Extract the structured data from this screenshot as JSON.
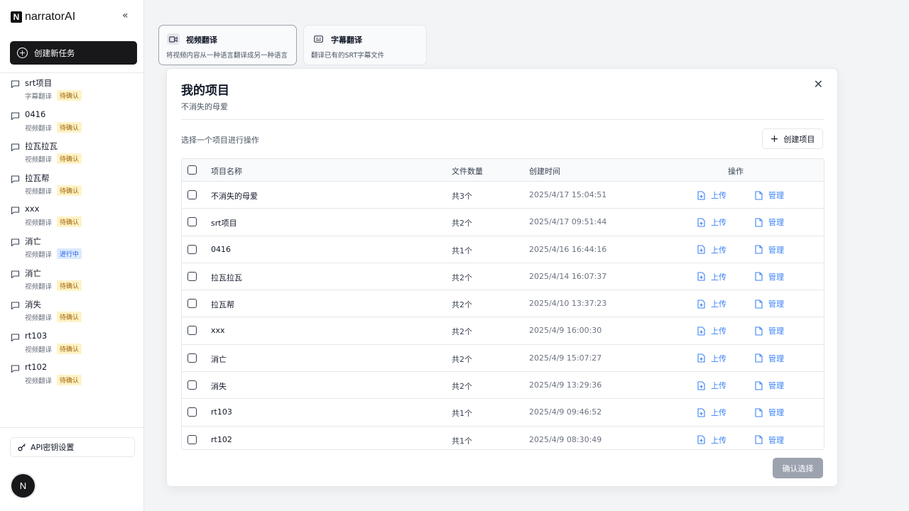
{
  "app": {
    "logo_letter": "N",
    "name": "narratorAI",
    "collapse_glyph": "«"
  },
  "sidebar": {
    "new_task_label": "创建新任务",
    "tasks": [
      {
        "title": "srt项目",
        "type": "字幕翻译",
        "status": "待确认",
        "status_kind": "pending"
      },
      {
        "title": "0416",
        "type": "视频翻译",
        "status": "待确认",
        "status_kind": "pending"
      },
      {
        "title": "拉瓦拉瓦",
        "type": "视频翻译",
        "status": "待确认",
        "status_kind": "pending"
      },
      {
        "title": "拉瓦帮",
        "type": "视频翻译",
        "status": "待确认",
        "status_kind": "pending"
      },
      {
        "title": "xxx",
        "type": "视频翻译",
        "status": "待确认",
        "status_kind": "pending"
      },
      {
        "title": "消亡",
        "type": "视频翻译",
        "status": "进行中",
        "status_kind": "progress"
      },
      {
        "title": "消亡",
        "type": "视频翻译",
        "status": "待确认",
        "status_kind": "pending"
      },
      {
        "title": "消失",
        "type": "视频翻译",
        "status": "待确认",
        "status_kind": "pending"
      },
      {
        "title": "rt103",
        "type": "视频翻译",
        "status": "待确认",
        "status_kind": "pending"
      },
      {
        "title": "rt102",
        "type": "视频翻译",
        "status": "待确认",
        "status_kind": "pending"
      }
    ],
    "api_settings_label": "API密钥设置",
    "avatar_letter": "N"
  },
  "modes": [
    {
      "title": "视频翻译",
      "desc": "将视频内容从一种语言翻译成另一种语言",
      "icon": "video-icon",
      "active": true
    },
    {
      "title": "字幕翻译",
      "desc": "翻译已有的SRT字幕文件",
      "icon": "subtitles-icon",
      "active": false
    }
  ],
  "modal": {
    "title": "我的项目",
    "subtitle": "不消失的母爱",
    "close_glyph": "✕",
    "hint": "选择一个项目进行操作",
    "create_project_label": "创建项目",
    "columns": {
      "name": "项目名称",
      "count": "文件数量",
      "time": "创建时间",
      "action": "操作"
    },
    "upload_label": "上传",
    "manage_label": "管理",
    "rows": [
      {
        "name": "不消失的母爱",
        "count": "共3个",
        "time": "2025/4/17 15:04:51"
      },
      {
        "name": "srt项目",
        "count": "共2个",
        "time": "2025/4/17 09:51:44"
      },
      {
        "name": "0416",
        "count": "共1个",
        "time": "2025/4/16 16:44:16"
      },
      {
        "name": "拉瓦拉瓦",
        "count": "共2个",
        "time": "2025/4/14 16:07:37"
      },
      {
        "name": "拉瓦帮",
        "count": "共2个",
        "time": "2025/4/10 13:37:23"
      },
      {
        "name": "xxx",
        "count": "共2个",
        "time": "2025/4/9 16:00:30"
      },
      {
        "name": "消亡",
        "count": "共2个",
        "time": "2025/4/9 15:07:27"
      },
      {
        "name": "消失",
        "count": "共2个",
        "time": "2025/4/9 13:29:36"
      },
      {
        "name": "rt103",
        "count": "共1个",
        "time": "2025/4/9 09:46:52"
      },
      {
        "name": "rt102",
        "count": "共1个",
        "time": "2025/4/9 08:30:49"
      }
    ],
    "confirm_label": "确认选择"
  },
  "colors": {
    "accent": "#3b82f6",
    "pending_bg": "#fef3c7",
    "progress_bg": "#dbeafe",
    "primary_dark": "#18181b"
  }
}
